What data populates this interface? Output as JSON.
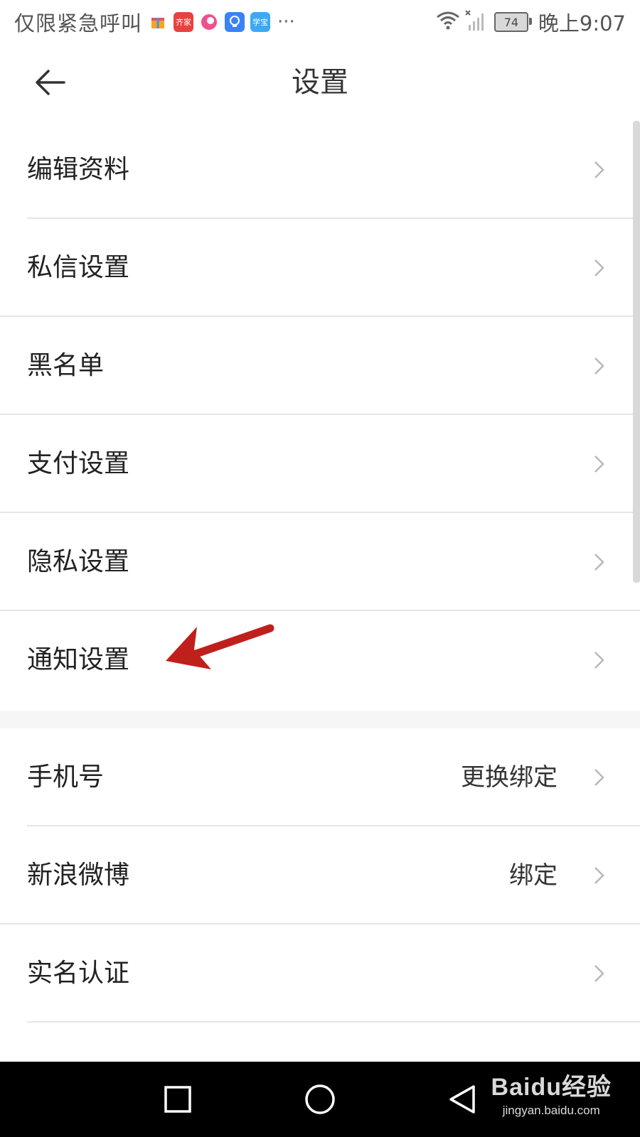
{
  "status_bar": {
    "left_text": "仅限紧急呼叫",
    "app_icons": [
      {
        "name": "gift-app-icon",
        "color": "#ff8a3d"
      },
      {
        "name": "qijia-app-icon",
        "color": "#e8423f",
        "label": "齐家"
      },
      {
        "name": "pink-app-icon",
        "color": "#f0508c"
      },
      {
        "name": "bulb-app-icon",
        "color": "#3b82f6"
      },
      {
        "name": "xuebao-app-icon",
        "color": "#3ea8f5",
        "label": "学宝"
      }
    ],
    "more": "···",
    "battery_level": "74",
    "time": "晚上9:07"
  },
  "header": {
    "back_icon": "arrow-left-icon",
    "title": "设置"
  },
  "settings_group_1": [
    {
      "label": "编辑资料",
      "value": ""
    },
    {
      "label": "私信设置",
      "value": ""
    },
    {
      "label": "黑名单",
      "value": ""
    },
    {
      "label": "支付设置",
      "value": ""
    },
    {
      "label": "隐私设置",
      "value": ""
    },
    {
      "label": "通知设置",
      "value": ""
    }
  ],
  "settings_group_2": [
    {
      "label": "手机号",
      "value": "更换绑定"
    },
    {
      "label": "新浪微博",
      "value": "绑定"
    },
    {
      "label": "实名认证",
      "value": ""
    }
  ],
  "annotation": {
    "color": "#c0201c",
    "icon": "red-arrow-pointer"
  },
  "nav_bar": {
    "recent_icon": "square-icon",
    "home_icon": "circle-icon",
    "back_icon": "triangle-back-icon"
  },
  "watermark": {
    "logo_text": "Baidu经验",
    "url": "jingyan.baidu.com"
  },
  "colors": {
    "divider": "#e6e6e6",
    "section_gap": "#f5f6f8",
    "chevron": "#b8b8b8",
    "title_text": "#333333",
    "label_text": "#222222"
  }
}
